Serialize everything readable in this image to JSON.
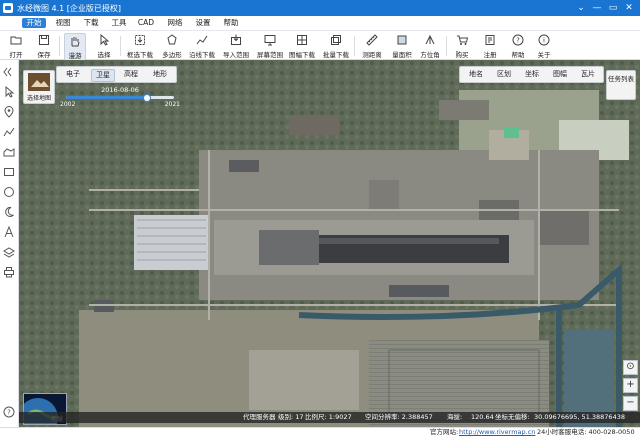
{
  "app": {
    "title": "水经微图 4.1 [企业版已授权]",
    "window_controls": [
      "⌄",
      "—",
      "▭",
      "✕"
    ]
  },
  "menu": [
    {
      "label": "开始",
      "active": true
    },
    {
      "label": "视图"
    },
    {
      "label": "下载"
    },
    {
      "label": "工具"
    },
    {
      "label": "CAD"
    },
    {
      "label": "网络"
    },
    {
      "label": "设置"
    },
    {
      "label": "帮助"
    }
  ],
  "toolbar": [
    {
      "label": "打开",
      "icon": "folder-icon"
    },
    {
      "label": "保存",
      "icon": "save-icon"
    },
    {
      "label": "漫游",
      "icon": "hand-icon",
      "active": true
    },
    {
      "label": "选择",
      "icon": "cursor-icon"
    },
    {
      "label": "框选下载",
      "icon": "box-download-icon"
    },
    {
      "label": "多边形",
      "icon": "polygon-icon"
    },
    {
      "label": "沿线下载",
      "icon": "line-download-icon"
    },
    {
      "label": "导入范围",
      "icon": "import-range-icon"
    },
    {
      "label": "屏幕范围",
      "icon": "screen-range-icon"
    },
    {
      "label": "图幅下载",
      "icon": "sheet-download-icon"
    },
    {
      "label": "批量下载",
      "icon": "batch-download-icon"
    },
    {
      "label": "测距离",
      "icon": "measure-distance-icon"
    },
    {
      "label": "量面积",
      "icon": "measure-area-icon"
    },
    {
      "label": "方位角",
      "icon": "azimuth-icon"
    },
    {
      "label": "购买",
      "icon": "cart-icon"
    },
    {
      "label": "注册",
      "icon": "register-icon"
    },
    {
      "label": "帮助",
      "icon": "help-icon"
    },
    {
      "label": "关于",
      "icon": "info-icon"
    }
  ],
  "sidebar_tools": [
    "collapse-icon",
    "select-arrow-icon",
    "pin-icon",
    "polyline-icon",
    "polygon-icon",
    "rectangle-icon",
    "circle-icon",
    "moon-icon",
    "text-icon",
    "layers-icon",
    "printer-icon",
    "question-icon"
  ],
  "map_picker": {
    "label": "选择地图"
  },
  "map_types": [
    {
      "label": "电子"
    },
    {
      "label": "卫星",
      "active": true
    },
    {
      "label": "高程"
    },
    {
      "label": "地形"
    }
  ],
  "timeline": {
    "date": "2016-08-06",
    "start_year": "2002",
    "end_year": "2021",
    "position": 0.74
  },
  "layer_tabs": [
    {
      "label": "地名"
    },
    {
      "label": "区划"
    },
    {
      "label": "坐标"
    },
    {
      "label": "图幅"
    },
    {
      "label": "瓦片"
    }
  ],
  "task_list": {
    "label": "任务列表"
  },
  "globe": {
    "label": "地球"
  },
  "zoom": {
    "plus": "+",
    "minus": "−"
  },
  "status": {
    "server": "代理服务器",
    "level": "级别: 17",
    "scale": "比例尺: 1:9027",
    "resolution": "空间分辨率: 2.388457",
    "elevation_label": "海拔:",
    "elevation": "120.64",
    "coord_label": "坐标无偏移:",
    "coords": "30.09676695, 51.38876438"
  },
  "footer": {
    "site_label": "官方网站:",
    "site": "http://www.rivermap.cn",
    "hotline": "24小时客服电话: 400-028-0050"
  }
}
